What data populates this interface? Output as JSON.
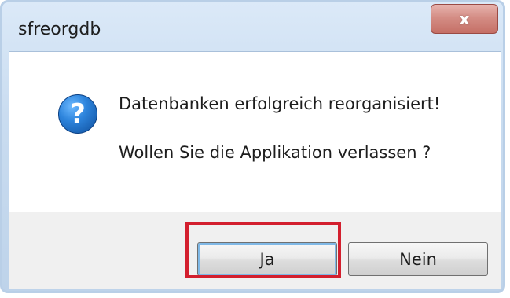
{
  "window": {
    "title": "sfreorgdb",
    "close_symbol": "x"
  },
  "message": {
    "line1": "Datenbanken erfolgreich reorganisiert!",
    "line2": "Wollen Sie die Applikation verlassen ?"
  },
  "buttons": {
    "yes_label": "Ja",
    "no_label": "Nein"
  },
  "icons": {
    "question": "?"
  },
  "colors": {
    "highlight_border": "#d31f2e",
    "close_button": "#d48d85",
    "question_icon": "#2d84dc"
  }
}
